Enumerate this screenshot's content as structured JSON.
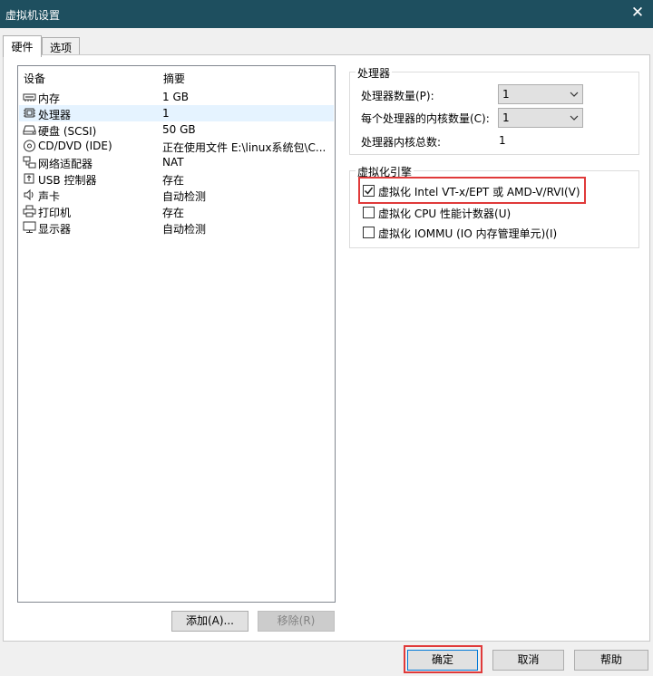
{
  "window": {
    "title": "虚拟机设置",
    "close_glyph": "✕"
  },
  "tabs": [
    {
      "label": "硬件",
      "active": true
    },
    {
      "label": "选项",
      "active": false
    }
  ],
  "device_list": {
    "columns": [
      "设备",
      "摘要"
    ],
    "rows": [
      {
        "name": "内存",
        "summary": "1 GB",
        "icon": "memory-icon",
        "selected": false
      },
      {
        "name": "处理器",
        "summary": "1",
        "icon": "processor-icon",
        "selected": true
      },
      {
        "name": "硬盘 (SCSI)",
        "summary": "50 GB",
        "icon": "hard-disk-icon",
        "selected": false
      },
      {
        "name": "CD/DVD (IDE)",
        "summary": "正在使用文件 E:\\linux系统包\\C...",
        "icon": "cd-dvd-icon",
        "selected": false
      },
      {
        "name": "网络适配器",
        "summary": "NAT",
        "icon": "network-adapter-icon",
        "selected": false
      },
      {
        "name": "USB 控制器",
        "summary": "存在",
        "icon": "usb-icon",
        "selected": false
      },
      {
        "name": "声卡",
        "summary": "自动检测",
        "icon": "sound-card-icon",
        "selected": false
      },
      {
        "name": "打印机",
        "summary": "存在",
        "icon": "printer-icon",
        "selected": false
      },
      {
        "name": "显示器",
        "summary": "自动检测",
        "icon": "display-icon",
        "selected": false
      }
    ],
    "add_button": "添加(A)...",
    "remove_button": "移除(R)"
  },
  "processor_group": {
    "title": "处理器",
    "processor_count_label": "处理器数量(P):",
    "processor_count_value": "1",
    "cores_per_processor_label": "每个处理器的内核数量(C):",
    "cores_per_processor_value": "1",
    "total_cores_label": "处理器内核总数:",
    "total_cores_value": "1"
  },
  "virtualization_group": {
    "title": "虚拟化引擎",
    "options": [
      {
        "label": "虚拟化 Intel VT-x/EPT 或 AMD-V/RVI(V)",
        "checked": true,
        "highlighted": true
      },
      {
        "label": "虚拟化 CPU 性能计数器(U)",
        "checked": false,
        "highlighted": false
      },
      {
        "label": "虚拟化 IOMMU (IO 内存管理单元)(I)",
        "checked": false,
        "highlighted": false
      }
    ]
  },
  "footer": {
    "ok_button": "确定",
    "cancel_button": "取消",
    "help_button": "帮助"
  },
  "colors": {
    "titlebar": "#1e4f5f",
    "highlight": "#e03a3a",
    "selection": "#e5f3ff"
  }
}
